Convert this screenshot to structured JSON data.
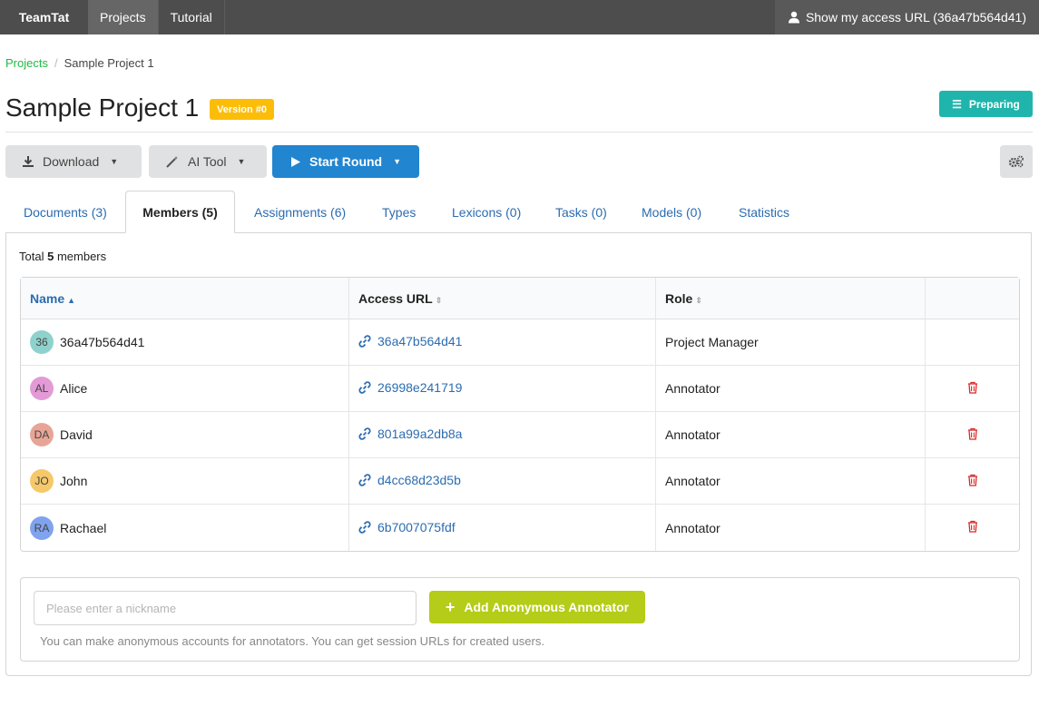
{
  "topbar": {
    "brand": "TeamTat",
    "nav": [
      "Projects",
      "Tutorial"
    ],
    "access_url_label": "Show my access URL (36a47b564d41)"
  },
  "breadcrumb": {
    "projects": "Projects",
    "current": "Sample Project 1"
  },
  "project": {
    "title": "Sample Project 1",
    "version": "Version #0",
    "status": "Preparing"
  },
  "toolbar": {
    "download": "Download",
    "ai_tool": "AI Tool",
    "start_round": "Start Round"
  },
  "tabs": [
    "Documents (3)",
    "Members (5)",
    "Assignments (6)",
    "Types",
    "Lexicons (0)",
    "Tasks (0)",
    "Models (0)",
    "Statistics"
  ],
  "members": {
    "total_prefix": "Total",
    "total_count": "5",
    "total_suffix": "members",
    "headers": {
      "name": "Name",
      "access_url": "Access URL",
      "role": "Role"
    },
    "rows": [
      {
        "initials": "36",
        "name": "36a47b564d41",
        "url": "36a47b564d41",
        "role": "Project Manager",
        "avatar_color": "#8fd1cc"
      },
      {
        "initials": "AL",
        "name": "Alice",
        "url": "26998e241719",
        "role": "Annotator",
        "avatar_color": "#e39ad6"
      },
      {
        "initials": "DA",
        "name": "David",
        "url": "801a99a2db8a",
        "role": "Annotator",
        "avatar_color": "#e8a597"
      },
      {
        "initials": "JO",
        "name": "John",
        "url": "d4cc68d23d5b",
        "role": "Annotator",
        "avatar_color": "#f5c86a"
      },
      {
        "initials": "RA",
        "name": "Rachael",
        "url": "6b7007075fdf",
        "role": "Annotator",
        "avatar_color": "#7fa3ee"
      }
    ]
  },
  "add_annotator": {
    "placeholder": "Please enter a nickname",
    "button": "Add Anonymous Annotator",
    "help": "You can make anonymous accounts for annotators. You can get session URLs for created users."
  }
}
